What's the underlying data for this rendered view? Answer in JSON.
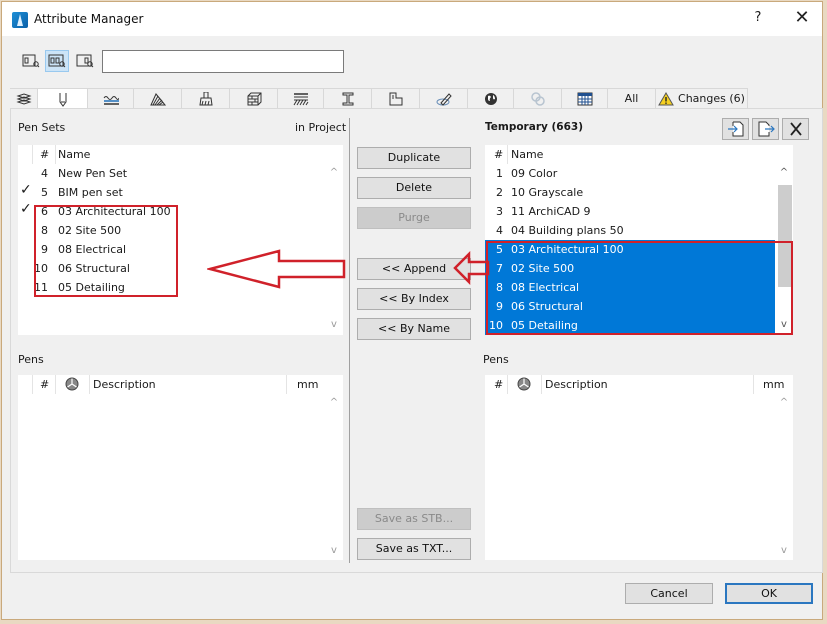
{
  "window": {
    "title": "Attribute Manager",
    "help_label": "?",
    "close_label": "✕"
  },
  "toolbar": {
    "view_buttons": [
      {
        "name": "show-project-only",
        "icon": "project-view-icon",
        "active": false
      },
      {
        "name": "show-both",
        "icon": "split-view-icon",
        "active": true
      },
      {
        "name": "show-temporary-only",
        "icon": "temporary-view-icon",
        "active": false
      }
    ],
    "search_value": "",
    "search_placeholder": ""
  },
  "tabs": [
    {
      "icon": "layers-icon",
      "label": ""
    },
    {
      "icon": "pen-icon",
      "label": "",
      "active": true
    },
    {
      "icon": "line-types-icon",
      "label": ""
    },
    {
      "icon": "fills-icon",
      "label": ""
    },
    {
      "icon": "surfaces-icon",
      "label": ""
    },
    {
      "icon": "building-materials-icon",
      "label": ""
    },
    {
      "icon": "composites-icon",
      "label": ""
    },
    {
      "icon": "profiles-icon",
      "label": ""
    },
    {
      "icon": "zones-icon",
      "label": ""
    },
    {
      "icon": "markup-styles-icon",
      "label": ""
    },
    {
      "icon": "location-icon",
      "label": ""
    },
    {
      "icon": "mep-systems-icon",
      "label": "",
      "disabled": true
    },
    {
      "icon": "operation-profiles-icon",
      "label": ""
    },
    {
      "icon": "",
      "label": "All"
    },
    {
      "icon": "warning-icon",
      "label": "Changes (6)"
    }
  ],
  "left": {
    "title": "Pen Sets",
    "source_label": "in Project",
    "columns": [
      "#",
      "Name"
    ],
    "rows": [
      {
        "num": "4",
        "name": "New Pen Set",
        "checked": false
      },
      {
        "num": "5",
        "name": "BIM pen set",
        "checked": true
      },
      {
        "num": "6",
        "name": "03 Architectural 100",
        "checked": true
      },
      {
        "num": "8",
        "name": "02 Site 500",
        "checked": false
      },
      {
        "num": "9",
        "name": "08 Electrical",
        "checked": false
      },
      {
        "num": "10",
        "name": "06 Structural",
        "checked": false
      },
      {
        "num": "11",
        "name": "05 Detailing",
        "checked": false
      }
    ],
    "pens_title": "Pens",
    "pens_columns": [
      "#",
      "",
      "Description",
      "mm"
    ]
  },
  "middle": {
    "duplicate_label": "Duplicate",
    "delete_label": "Delete",
    "purge_label": "Purge",
    "append_label": "<< Append",
    "by_index_label": "<< By Index",
    "by_name_label": "<< By Name",
    "save_stb_label": "Save as STB...",
    "save_txt_label": "Save as TXT..."
  },
  "right": {
    "title": "Temporary (663)",
    "columns": [
      "#",
      "Name"
    ],
    "rows": [
      {
        "num": "1",
        "name": "09 Color",
        "selected": false
      },
      {
        "num": "2",
        "name": "10 Grayscale",
        "selected": false
      },
      {
        "num": "3",
        "name": "11 ArchiCAD 9",
        "selected": false
      },
      {
        "num": "4",
        "name": "04 Building plans 50",
        "selected": false
      },
      {
        "num": "5",
        "name": "03 Architectural 100",
        "selected": true
      },
      {
        "num": "7",
        "name": "02 Site 500",
        "selected": true
      },
      {
        "num": "8",
        "name": "08 Electrical",
        "selected": true
      },
      {
        "num": "9",
        "name": "06 Structural",
        "selected": true
      },
      {
        "num": "10",
        "name": "05 Detailing",
        "selected": true
      }
    ],
    "pens_title": "Pens",
    "pens_columns": [
      "#",
      "",
      "Description",
      "mm"
    ]
  },
  "footer": {
    "cancel_label": "Cancel",
    "ok_label": "OK"
  },
  "colors": {
    "selection": "#0078d7",
    "annotation": "#d0212a",
    "default_button_border": "#2b77c0"
  }
}
